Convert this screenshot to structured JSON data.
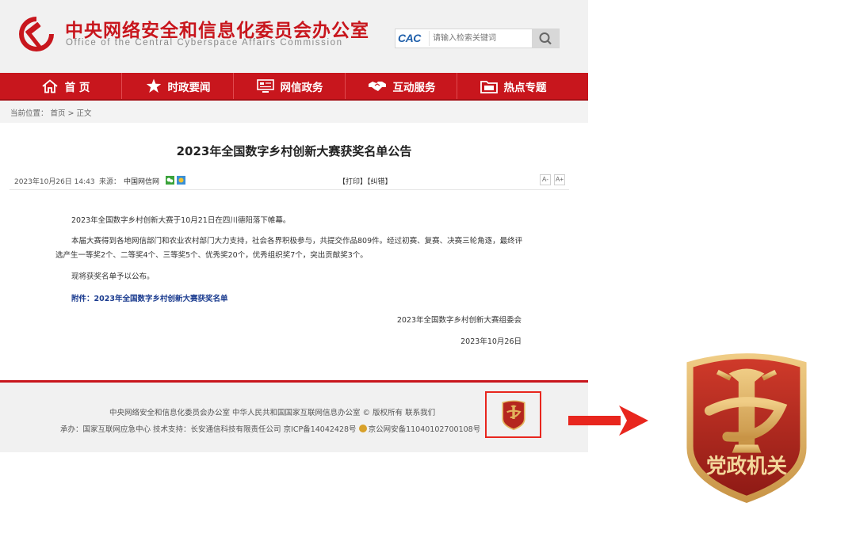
{
  "header": {
    "title": "中央网络安全和信息化委员会办公室",
    "subtitle": "Office of the Central Cyberspace Affairs Commission",
    "search_logo": "CAC",
    "search_placeholder": "请输入检索关键词"
  },
  "nav": [
    {
      "label": "首 页",
      "icon": "home-icon"
    },
    {
      "label": "时政要闻",
      "icon": "star-icon"
    },
    {
      "label": "网信政务",
      "icon": "monitor-icon"
    },
    {
      "label": "互动服务",
      "icon": "handshake-icon"
    },
    {
      "label": "热点专题",
      "icon": "folder-icon"
    }
  ],
  "breadcrumb": "当前位置： 首页 > 正文",
  "article": {
    "title": "2023年全国数字乡村创新大赛获奖名单公告",
    "date": "2023年10月26日 14:43",
    "source_label": "来源：",
    "source": "中国网信网",
    "actions": "【打印】【纠错】",
    "font_small": "A-",
    "font_large": "A+",
    "p1": "2023年全国数字乡村创新大赛于10月21日在四川德阳落下帷幕。",
    "p2a": "本届大赛得到各地网信部门和农业农村部门大力支持，社会各界积极参与，共提交作品809件。经过初赛、复赛、决赛三轮角逐，最终评",
    "p2b": "选产生一等奖2个、二等奖4个、三等奖5个、优秀奖20个，优秀组织奖7个，突出贡献奖3个。",
    "p3": "现将获奖名单予以公布。",
    "attachment": "附件：2023年全国数字乡村创新大赛获奖名单",
    "signature": "2023年全国数字乡村创新大赛组委会",
    "sign_date": "2023年10月26日"
  },
  "footer": {
    "line1": "中央网络安全和信息化委员会办公室   中华人民共和国国家互联网信息办公室 © 版权所有   联系我们",
    "line2a": "承办：国家互联网应急中心   技术支持：长安通信科技有限责任公司   京ICP备14042428号  ",
    "line2b": "京公网安备11040102700108号",
    "badge_text": "党政机关"
  },
  "colors": {
    "brand_red": "#c8161d",
    "gold": "#e2b25c",
    "badge_red": "#b5261e"
  }
}
